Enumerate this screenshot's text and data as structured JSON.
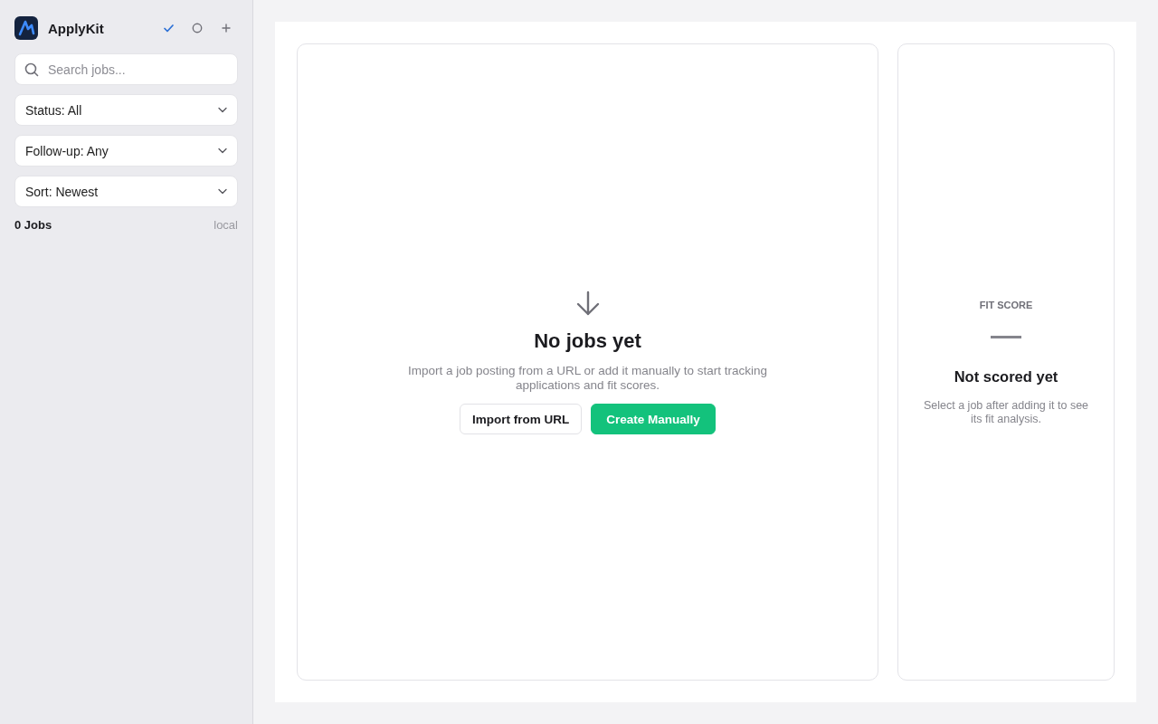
{
  "sidebar": {
    "app_name": "ApplyKit",
    "header_actions": [
      {
        "kind": "check",
        "selected": true
      },
      {
        "kind": "circle",
        "selected": false
      },
      {
        "kind": "plus",
        "selected": false
      }
    ],
    "search": {
      "placeholder": "Search jobs..."
    },
    "filters": [
      {
        "label": "Status: All"
      },
      {
        "label": "Follow-up: Any"
      },
      {
        "label": "Sort: Newest"
      }
    ],
    "job_count": "0 Jobs",
    "storage": "local"
  },
  "empty_state": {
    "title": "No jobs yet",
    "description": "Import a job posting from a URL or add it manually to start tracking applications and fit scores.",
    "buttons": [
      {
        "label": "Import from URL",
        "kind": "secondary"
      },
      {
        "label": "Create Manually",
        "kind": "primary"
      }
    ]
  },
  "fit_panel": {
    "heading": "FIT SCORE",
    "title": "Not scored yet",
    "description": "Select a job after adding it to see its fit analysis."
  }
}
